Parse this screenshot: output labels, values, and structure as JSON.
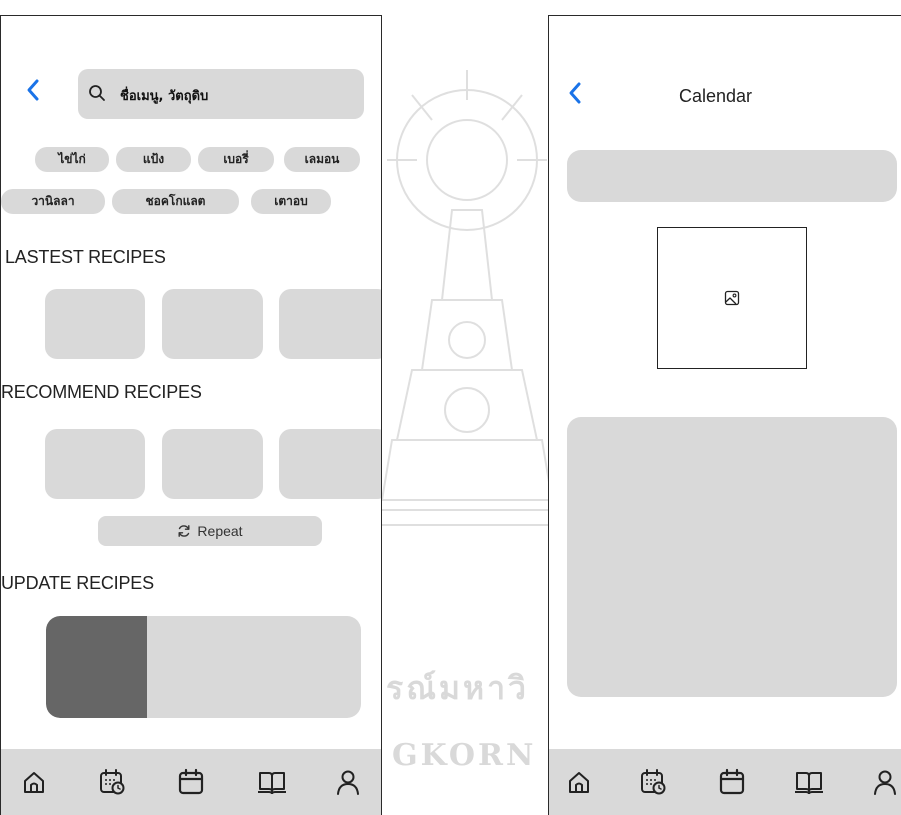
{
  "watermark": {
    "line1": "รณ์มหาวิ",
    "line2": "GKORN UN"
  },
  "left_screen": {
    "back_icon": "chevron-left-icon",
    "search": {
      "icon": "search-icon",
      "placeholder": "ชื่อเมนู, วัตถุดิบ"
    },
    "chips": [
      "ไข่ไก่",
      "แป้ง",
      "เบอรี่",
      "เลมอน",
      "วานิลลา",
      "ชอคโกแลต",
      "เตาอบ"
    ],
    "sections": {
      "latest_title": "LASTEST RECIPES",
      "recommend_title": "RECOMMEND RECIPES",
      "update_title": "UPDATE RECIPES"
    },
    "repeat_button": {
      "icon": "refresh-icon",
      "label": "Repeat"
    },
    "update_progress": 0.32
  },
  "right_screen": {
    "back_icon": "chevron-left-icon",
    "title": "Calendar",
    "image_placeholder_icon": "image-icon"
  },
  "navbar": {
    "items": [
      {
        "name": "home",
        "icon": "home-icon"
      },
      {
        "name": "calendar-clock",
        "icon": "calendar-clock-icon"
      },
      {
        "name": "calendar",
        "icon": "calendar-icon"
      },
      {
        "name": "recipe-book",
        "icon": "book-open-icon"
      },
      {
        "name": "profile",
        "icon": "user-icon"
      }
    ]
  },
  "colors": {
    "accent": "#1a73e8",
    "placeholder": "#d9d9d9",
    "progress_fill": "#666666",
    "border": "#2a2a2a"
  }
}
